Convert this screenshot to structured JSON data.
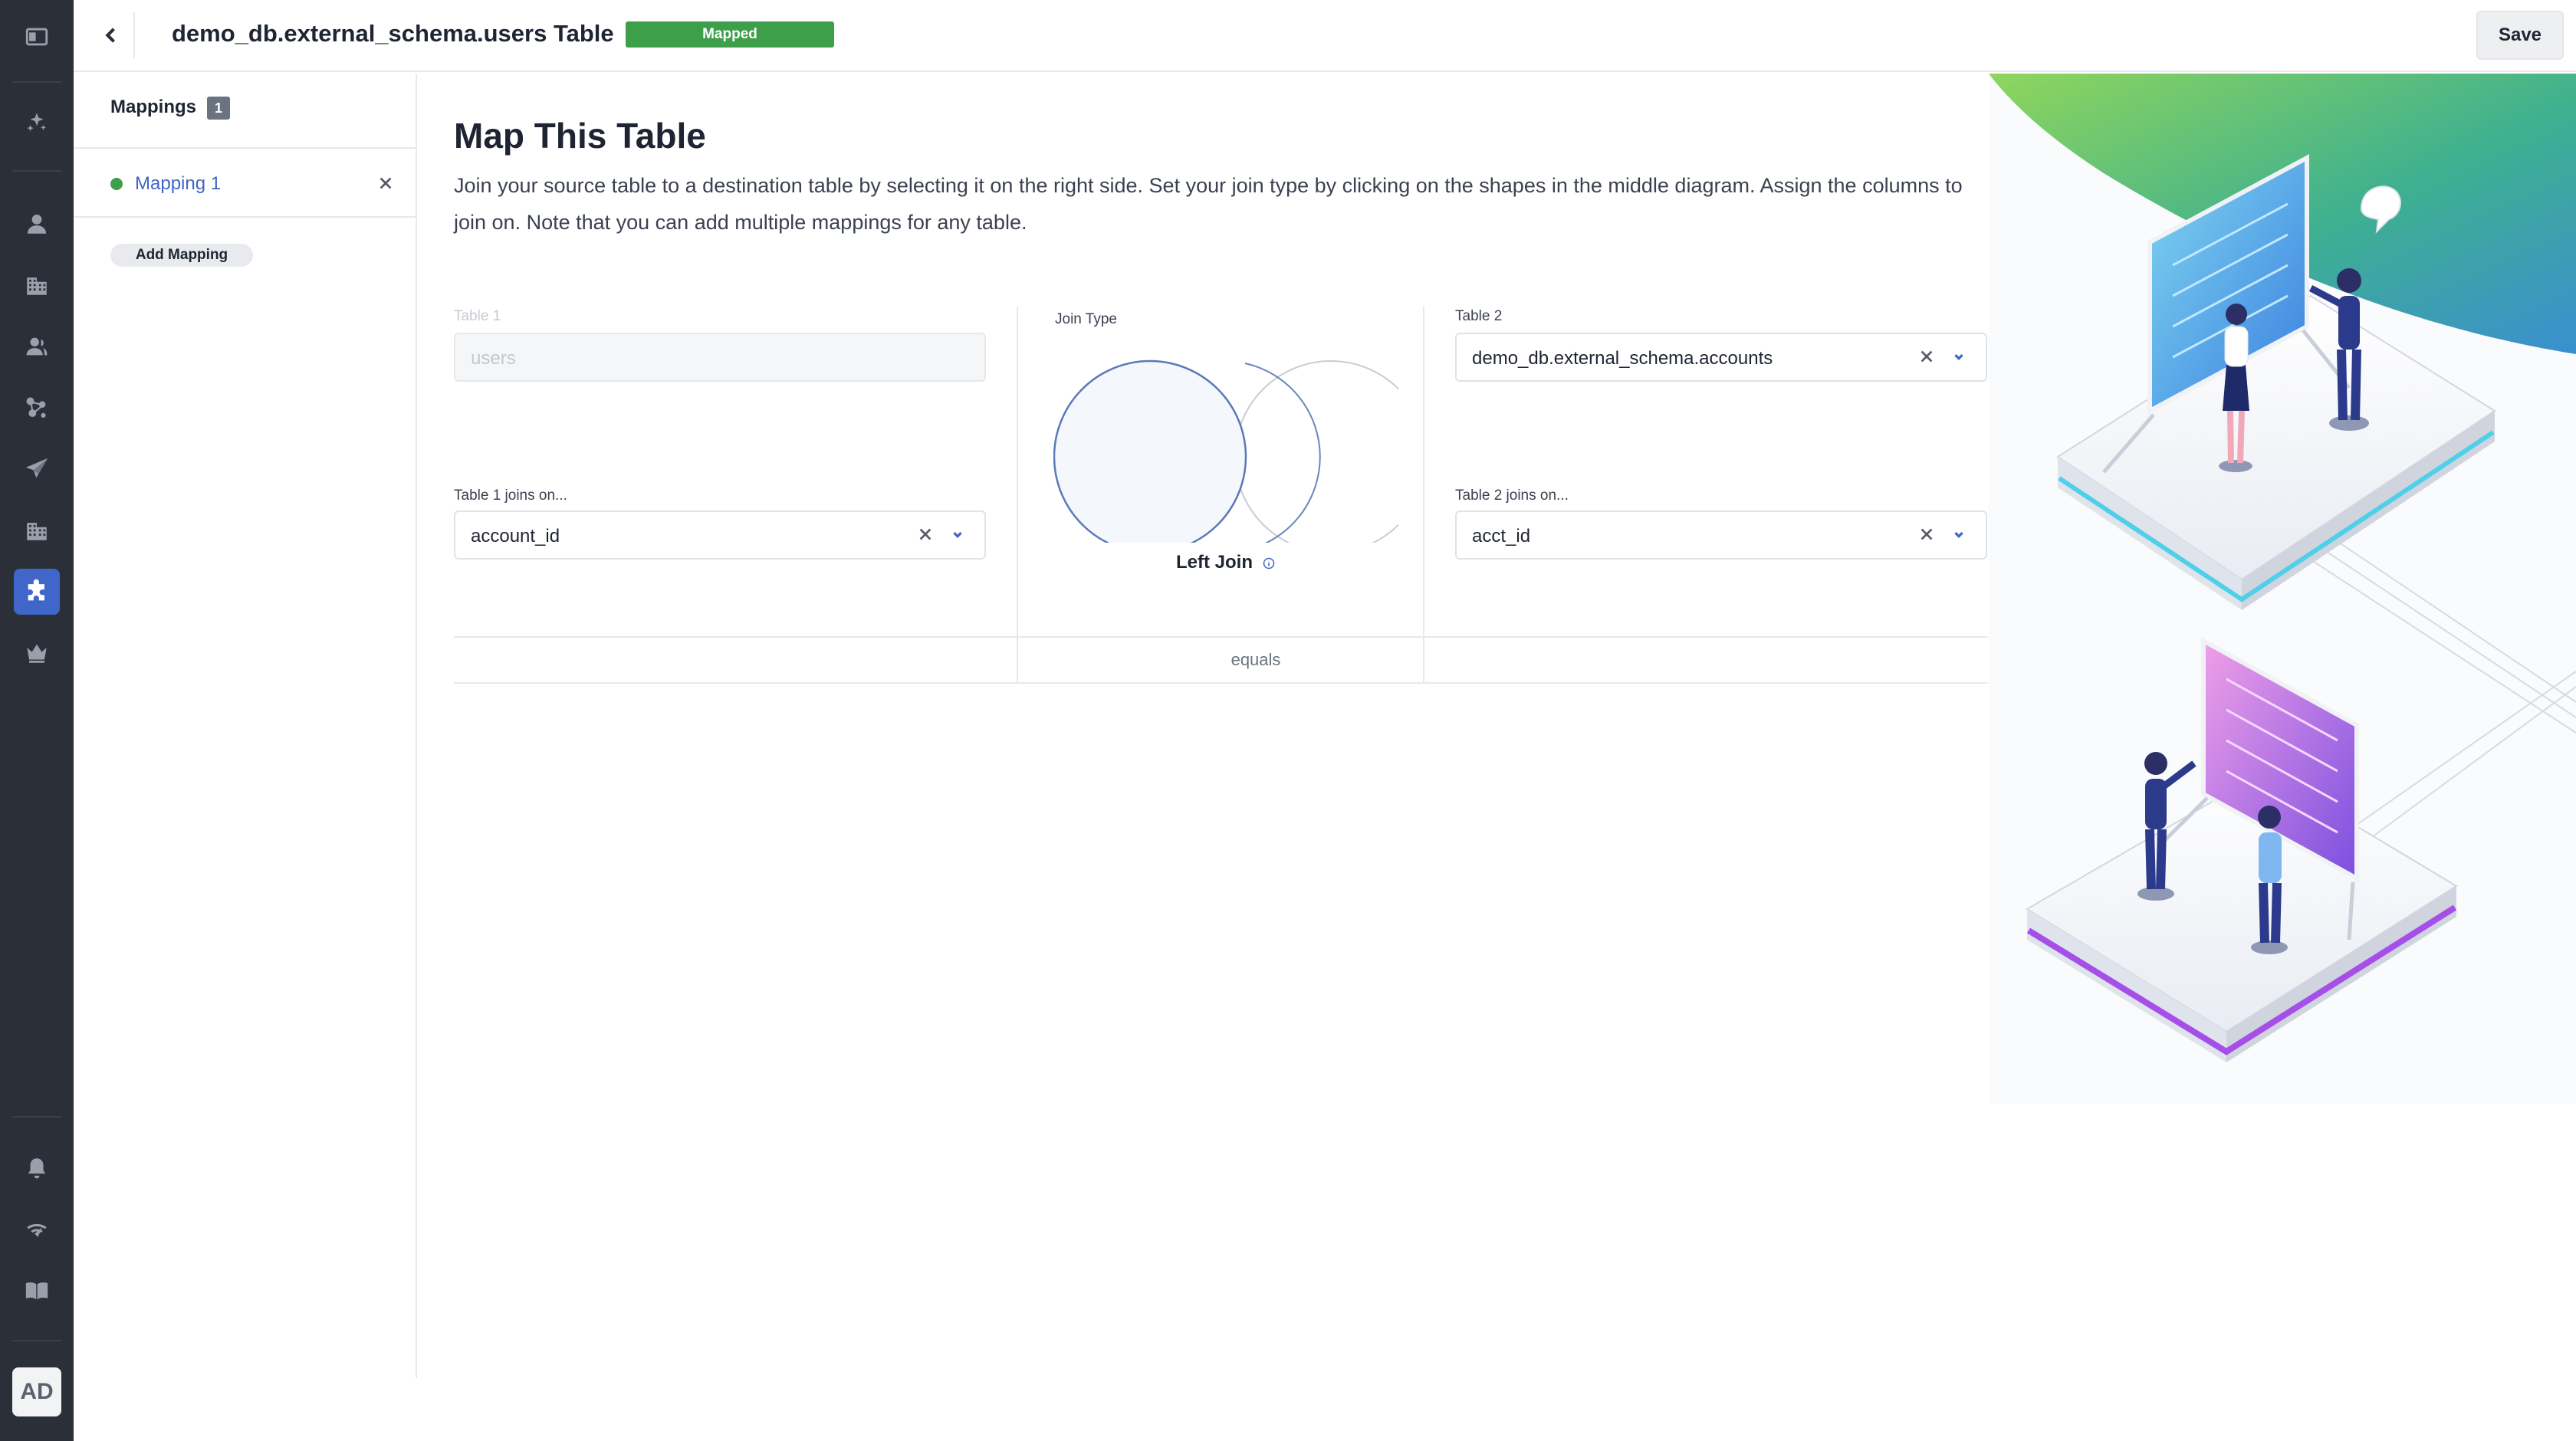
{
  "header": {
    "title": "demo_db.external_schema.users Table",
    "status_badge": "Mapped",
    "save_label": "Save"
  },
  "rail": {
    "items": [
      {
        "name": "sidebar-toggle",
        "icon": "panel-icon"
      },
      {
        "name": "sparkles",
        "icon": "sparkles-icon"
      },
      {
        "name": "users",
        "icon": "user-icon"
      },
      {
        "name": "accounts",
        "icon": "building-icon"
      },
      {
        "name": "contacts",
        "icon": "person-icon"
      },
      {
        "name": "segments",
        "icon": "nodes-icon"
      },
      {
        "name": "campaigns",
        "icon": "paper-plane-icon"
      },
      {
        "name": "companies",
        "icon": "building-icon"
      },
      {
        "name": "integrations",
        "icon": "puzzle-icon",
        "active": true
      },
      {
        "name": "premium",
        "icon": "crown-icon"
      },
      {
        "name": "notifications",
        "icon": "bell-icon"
      },
      {
        "name": "signal",
        "icon": "signal-icon"
      },
      {
        "name": "docs",
        "icon": "book-icon"
      }
    ],
    "avatar": "AD"
  },
  "sidebar": {
    "title": "Mappings",
    "count": "1",
    "items": [
      {
        "label": "Mapping 1",
        "status_color": "#3e9f4a"
      }
    ],
    "add_label": "Add Mapping"
  },
  "main": {
    "title": "Map This Table",
    "description": "Join your source table to a destination table by selecting it on the right side. Set your join type by clicking on the shapes in the middle diagram. Assign the columns to join on. Note that you can add multiple mappings for any table.",
    "table1": {
      "label": "Table 1",
      "value": "users"
    },
    "table1_join": {
      "label": "Table 1 joins on...",
      "value": "account_id"
    },
    "join_type": {
      "label": "Join Type",
      "value": "Left Join"
    },
    "table2": {
      "label": "Table 2",
      "value": "demo_db.external_schema.accounts"
    },
    "table2_join": {
      "label": "Table 2 joins on...",
      "value": "acct_id"
    },
    "equals_label": "equals"
  },
  "colors": {
    "accent": "#3f66c8",
    "success": "#3e9f4a",
    "rail": "#2b2f38"
  }
}
